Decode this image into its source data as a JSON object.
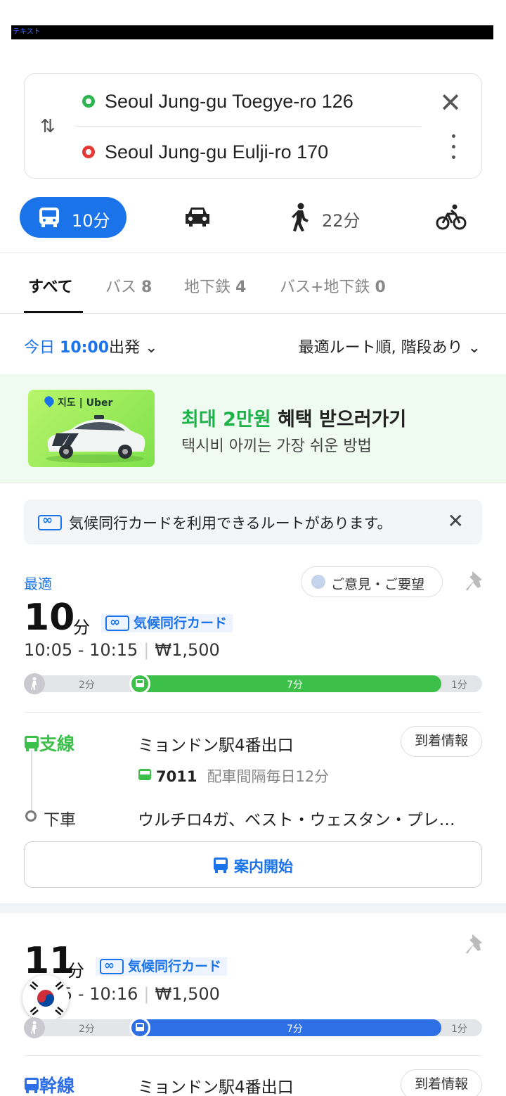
{
  "status": {
    "label": "テキスト"
  },
  "search": {
    "from": "Seoul Jung-gu Toegye-ro 126",
    "to": "Seoul Jung-gu Eulji-ro 170"
  },
  "modes": {
    "bus_time": "10分",
    "walk_time": "22分"
  },
  "tabs": [
    {
      "label": "すべて",
      "count": ""
    },
    {
      "label": "バス",
      "count": "8"
    },
    {
      "label": "地下鉄",
      "count": "4"
    },
    {
      "label": "バス+地下鉄",
      "count": "0"
    }
  ],
  "departure": {
    "day": "今日",
    "time": "10:00",
    "suffix": "出発",
    "sort": "最適ルート順, 階段あり"
  },
  "banner": {
    "brand": "지도 | Uber",
    "title_highlight": "최대 2만원",
    "title_rest": " 혜택 받으러가기",
    "subtitle": "택시비 아끼는 가장 쉬운 방법"
  },
  "info_bar": {
    "text": "気候同行カードを利用できるルートがあります。"
  },
  "routes": [
    {
      "badge": "最適",
      "feedback": "ご意見・ご要望",
      "duration": "10",
      "unit": "分",
      "card_tag": "気候同行カード",
      "time_range": "10:05 - 10:15",
      "fare": "₩1,500",
      "walk_before": "2分",
      "ride": "7分",
      "walk_after": "1分",
      "leg_kind": "支線",
      "leg_stop": "ミョンドン駅4番出口",
      "arrival_btn": "到着情報",
      "bus_number": "7011",
      "interval": "配車間隔毎日12分",
      "alight_label": "下車",
      "alight_stop": "ウルチロ4ガ、ベスト・ウェスタン・プレ…",
      "start_nav": "案内開始",
      "color": "#3cc04a"
    },
    {
      "duration": "11",
      "unit": "分",
      "card_tag": "気候同行カード",
      "time_range": "5 - 10:16",
      "fare": "₩1,500",
      "walk_before": "2分",
      "ride": "7分",
      "walk_after": "1分",
      "leg_kind": "幹線",
      "leg_stop": "ミョンドン駅4番出口",
      "arrival_btn": "到着情報",
      "color": "#2f6fe6"
    }
  ]
}
